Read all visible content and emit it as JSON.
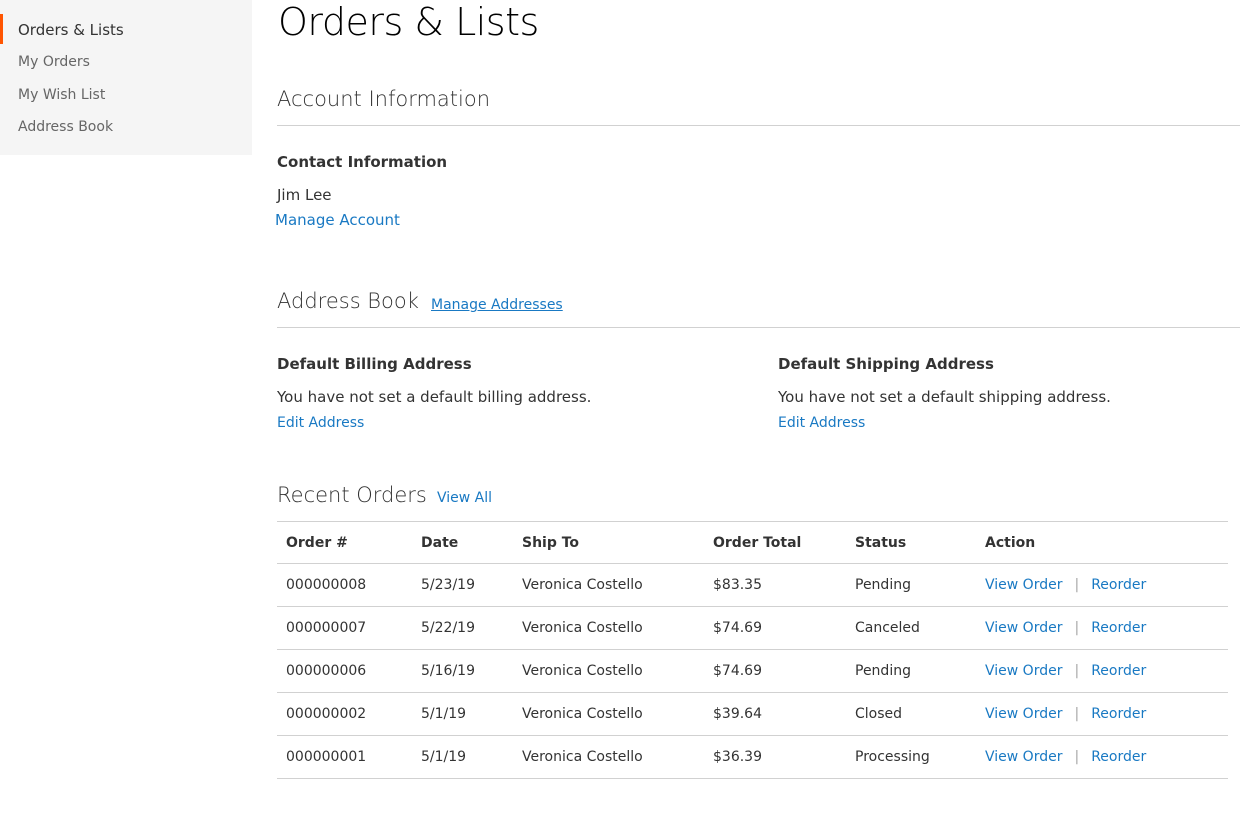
{
  "sidebar": {
    "items": [
      {
        "label": "Orders & Lists"
      },
      {
        "label": "My Orders"
      },
      {
        "label": "My Wish List"
      },
      {
        "label": "Address Book"
      }
    ]
  },
  "page": {
    "title": "Orders & Lists"
  },
  "account_info": {
    "title": "Account Information",
    "contact": {
      "title": "Contact Information",
      "name": "Jim Lee",
      "manage_link": "Manage Account"
    }
  },
  "address_book": {
    "title": "Address Book",
    "manage_link": "Manage Addresses",
    "billing": {
      "title": "Default Billing Address",
      "text": "You have not set a default billing address.",
      "edit_link": "Edit Address"
    },
    "shipping": {
      "title": "Default Shipping Address",
      "text": "You have not set a default shipping address.",
      "edit_link": "Edit Address"
    }
  },
  "recent_orders": {
    "title": "Recent Orders",
    "view_all": "View All",
    "columns": [
      "Order #",
      "Date",
      "Ship To",
      "Order Total",
      "Status",
      "Action"
    ],
    "rows": [
      {
        "order": "000000008",
        "date": "5/23/19",
        "ship_to": "Veronica Costello",
        "total": "$83.35",
        "status": "Pending",
        "view": "View Order",
        "reorder": "Reorder"
      },
      {
        "order": "000000007",
        "date": "5/22/19",
        "ship_to": "Veronica Costello",
        "total": "$74.69",
        "status": "Canceled",
        "view": "View Order",
        "reorder": "Reorder"
      },
      {
        "order": "000000006",
        "date": "5/16/19",
        "ship_to": "Veronica Costello",
        "total": "$74.69",
        "status": "Pending",
        "view": "View Order",
        "reorder": "Reorder"
      },
      {
        "order": "000000002",
        "date": "5/1/19",
        "ship_to": "Veronica Costello",
        "total": "$39.64",
        "status": "Closed",
        "view": "View Order",
        "reorder": "Reorder"
      },
      {
        "order": "000000001",
        "date": "5/1/19",
        "ship_to": "Veronica Costello",
        "total": "$36.39",
        "status": "Processing",
        "view": "View Order",
        "reorder": "Reorder"
      }
    ]
  },
  "colors": {
    "accent": "#ff5501",
    "link": "#1979c3",
    "sidebar_bg": "#f5f5f5"
  }
}
